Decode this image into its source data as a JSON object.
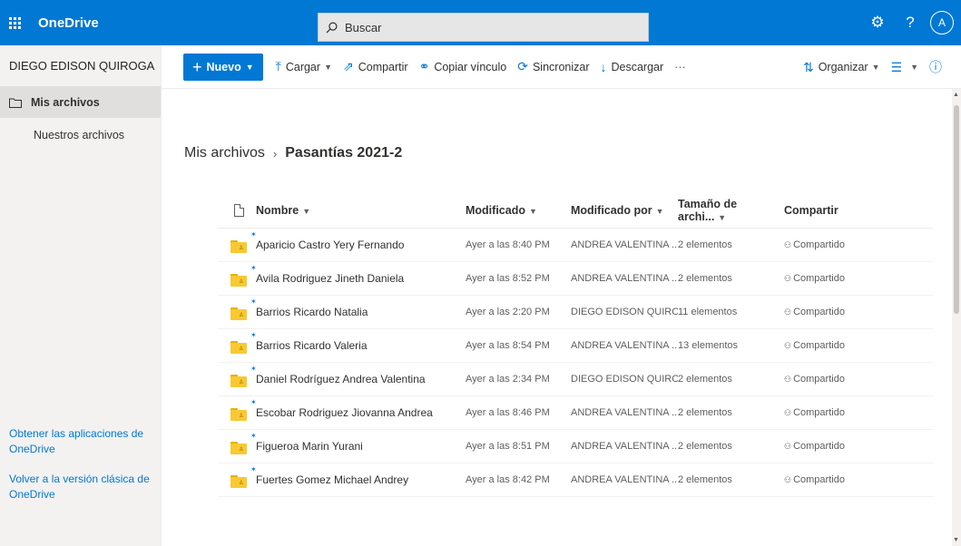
{
  "app": {
    "title": "OneDrive",
    "search_placeholder": "Buscar",
    "avatar_initial": "A",
    "accent_color": "#0078d4"
  },
  "nav": {
    "user": "DIEGO EDISON QUIROGA",
    "items": [
      {
        "label": "Mis archivos",
        "active": true
      },
      {
        "label": "Nuestros archivos",
        "active": false
      }
    ],
    "bottom_links": [
      "Obtener las aplicaciones de OneDrive",
      "Volver a la versión clásica de OneDrive"
    ]
  },
  "toolbar": {
    "new_label": "Nuevo",
    "upload_label": "Cargar",
    "share_label": "Compartir",
    "copy_link_label": "Copiar vínculo",
    "sync_label": "Sincronizar",
    "download_label": "Descargar",
    "more_label": "···",
    "sort_label": "Organizar"
  },
  "breadcrumb": {
    "root": "Mis archivos",
    "current": "Pasantías 2021-2"
  },
  "table": {
    "headers": {
      "name": "Nombre",
      "modified": "Modificado",
      "modified_by": "Modificado por",
      "size": "Tamaño de archi...",
      "sharing": "Compartir"
    },
    "rows": [
      {
        "name": "Aparicio Castro Yery Fernando",
        "modified": "Ayer a las 8:40 PM",
        "modified_by": "ANDREA VALENTINA ...",
        "size": "2 elementos",
        "sharing": "Compartido"
      },
      {
        "name": "Avila Rodriguez Jineth Daniela",
        "modified": "Ayer a las 8:52 PM",
        "modified_by": "ANDREA VALENTINA ...",
        "size": "2 elementos",
        "sharing": "Compartido"
      },
      {
        "name": "Barrios Ricardo Natalia",
        "modified": "Ayer a las 2:20 PM",
        "modified_by": "DIEGO EDISON QUIRO...",
        "size": "11 elementos",
        "sharing": "Compartido"
      },
      {
        "name": "Barrios Ricardo Valeria",
        "modified": "Ayer a las 8:54 PM",
        "modified_by": "ANDREA VALENTINA ...",
        "size": "13 elementos",
        "sharing": "Compartido"
      },
      {
        "name": "Daniel Rodríguez Andrea Valentina",
        "modified": "Ayer a las 2:34 PM",
        "modified_by": "DIEGO EDISON QUIRO...",
        "size": "2 elementos",
        "sharing": "Compartido"
      },
      {
        "name": "Escobar Rodriguez Jiovanna Andrea",
        "modified": "Ayer a las 8:46 PM",
        "modified_by": "ANDREA VALENTINA ...",
        "size": "2 elementos",
        "sharing": "Compartido"
      },
      {
        "name": "Figueroa Marin Yurani",
        "modified": "Ayer a las 8:51 PM",
        "modified_by": "ANDREA VALENTINA ...",
        "size": "2 elementos",
        "sharing": "Compartido"
      },
      {
        "name": "Fuertes Gomez Michael Andrey",
        "modified": "Ayer a las 8:42 PM",
        "modified_by": "ANDREA VALENTINA ...",
        "size": "2 elementos",
        "sharing": "Compartido"
      }
    ]
  }
}
